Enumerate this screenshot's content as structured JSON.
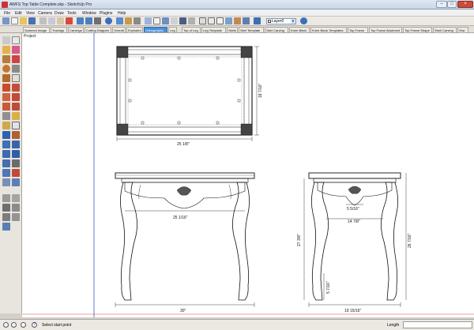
{
  "window": {
    "title": "AWFS Top Table Complete.skp - SketchUp Pro"
  },
  "menu": [
    "File",
    "Edit",
    "View",
    "Camera",
    "Draw",
    "Tools",
    "Window",
    "Plugins",
    "Help"
  ],
  "toolbar": {
    "layer_value": "Layer0"
  },
  "scene_tabs": [
    {
      "label": "Scanned Image",
      "active": false
    },
    {
      "label": "Tracings",
      "active": false
    },
    {
      "label": "Carvings",
      "active": false
    },
    {
      "label": "Cutting Diagram",
      "active": false
    },
    {
      "label": "Overall",
      "active": false
    },
    {
      "label": "Exploded",
      "active": false
    },
    {
      "label": "Orthographic",
      "active": true
    },
    {
      "label": "Leg",
      "active": false
    },
    {
      "label": "Top of Leg",
      "active": false
    },
    {
      "label": "Leg Template",
      "active": false
    },
    {
      "label": "Skirts",
      "active": false
    },
    {
      "label": "Skirt Template",
      "active": false
    },
    {
      "label": "Skirt Carving",
      "active": false
    },
    {
      "label": "Knee Block",
      "active": false
    },
    {
      "label": "Knee Block Templates",
      "active": false
    },
    {
      "label": "Top Frame",
      "active": false
    },
    {
      "label": "Top Frame Abutment",
      "active": false
    },
    {
      "label": "Top Frame Shape",
      "active": false
    },
    {
      "label": "Shell Carving",
      "active": false
    },
    {
      "label": "Sha",
      "active": false
    }
  ],
  "viewport": {
    "scene_label": "Project",
    "dimensions": {
      "top_width": "25 1/8\"",
      "top_depth": "18 7/16\"",
      "front_skirt": "25 1/16\"",
      "front_overall": "30\"",
      "side_inner_a": "5 5/16\"",
      "side_inner_b": "14 7/8\"",
      "side_height": "27 3/8\"",
      "side_overall_height": "26 7/16\"",
      "side_foot": "5 7/16\"",
      "side_overall": "19 15/16\""
    }
  },
  "statusbar": {
    "hint": "Select start point",
    "measure_label": "Length"
  }
}
